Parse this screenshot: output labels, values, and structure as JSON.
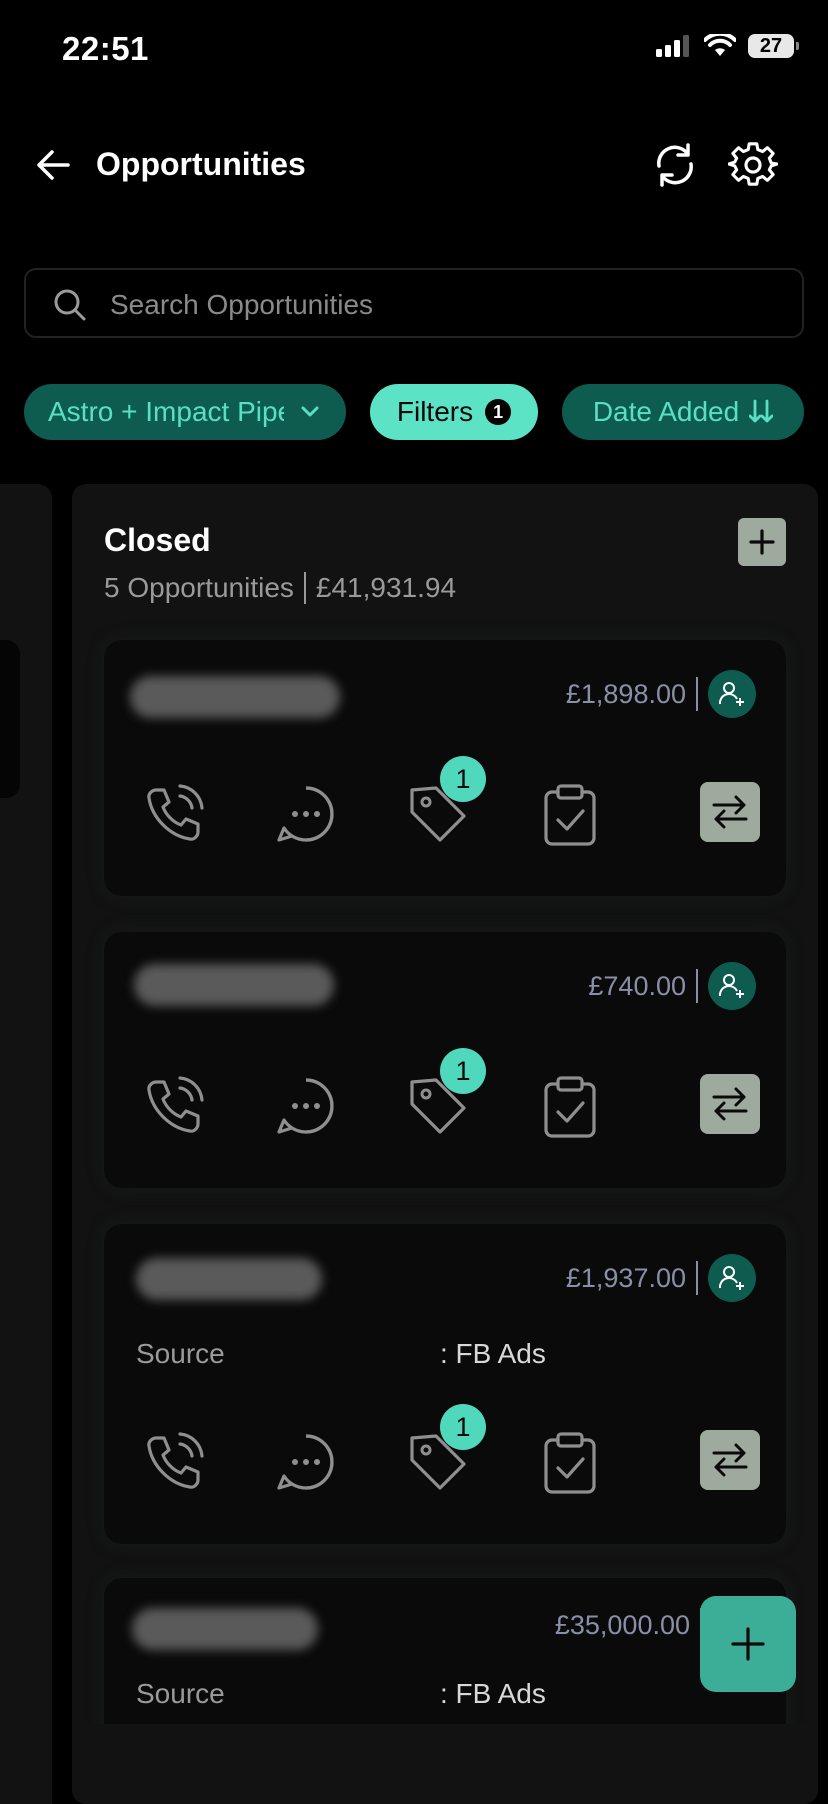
{
  "status_bar": {
    "time": "22:51",
    "battery": "27"
  },
  "header": {
    "title": "Opportunities"
  },
  "search": {
    "placeholder": "Search Opportunities",
    "value": ""
  },
  "chips": {
    "pipeline": "Astro + Impact Pipeline",
    "filters": "Filters",
    "filters_count": "1",
    "sort": "Date Added"
  },
  "column": {
    "title": "Closed",
    "count": "5 Opportunities",
    "total": "£41,931.94",
    "cards": [
      {
        "amount": "£1,898.00",
        "tag_count": "1"
      },
      {
        "amount": "£740.00",
        "tag_count": "1"
      },
      {
        "amount": "£1,937.00",
        "source_label": "Source",
        "source_value": ": FB Ads",
        "tag_count": "1"
      },
      {
        "amount": "£35,000.00",
        "source_label": "Source",
        "source_value": ": FB Ads"
      }
    ]
  },
  "colors": {
    "accent": "#5ce3c6",
    "chip_dark": "#0d5c4f",
    "fab": "#3cae97",
    "panel": "#121212"
  }
}
